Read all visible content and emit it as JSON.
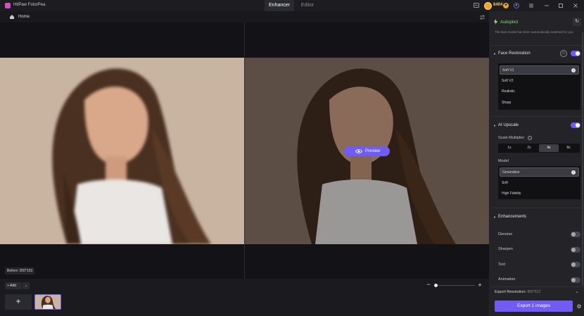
{
  "titlebar": {
    "app_title": "HitPaw FotorPea",
    "tabs": [
      {
        "label": "Enhancer",
        "active": true
      },
      {
        "label": "Editor",
        "active": false
      }
    ],
    "credits": "8404",
    "icons": [
      "message-icon",
      "coin-icon",
      "add-credits-icon",
      "account-icon",
      "menu-icon",
      "minimize-icon",
      "maximize-icon",
      "close-icon"
    ]
  },
  "homebar": {
    "home_label": "Home"
  },
  "canvas": {
    "preview_label": "Preview",
    "before_tag": "Before: 200*153"
  },
  "bottom": {
    "add_label": "Add",
    "add_icon": "+",
    "caret": "⌄",
    "zoom_minus": "−",
    "zoom_plus": "+",
    "zoom_level": 0.0,
    "thumb_add": "+"
  },
  "panel": {
    "autopilot_label": "Autopilot",
    "autopilot_desc": "The best model has been automatically matched for you",
    "face_restoration": {
      "label": "Face Restoration",
      "enabled": true,
      "options": [
        "Soft V1",
        "Soft V2",
        "Realistic",
        "Sharp"
      ],
      "selected": "Soft V1"
    },
    "ai_upscale": {
      "label": "AI Upscale",
      "enabled": true,
      "scale_label": "Scale Multiplier",
      "scales": [
        "1x",
        "2x",
        "4x",
        "8x"
      ],
      "selected_scale": "4x",
      "model_label": "Model",
      "models": [
        "Generative",
        "Soft",
        "High Fidelity"
      ],
      "selected_model": "Generative"
    },
    "enhancements": {
      "label": "Enhancements",
      "items": [
        {
          "label": "Denoise",
          "enabled": false
        },
        {
          "label": "Sharpen",
          "enabled": false
        },
        {
          "label": "Text",
          "enabled": false
        },
        {
          "label": "Animation",
          "enabled": false
        }
      ]
    },
    "export_res_label": "Export Resolution:",
    "export_res_value": "800*612",
    "export_button": "Export 1 images"
  },
  "colors": {
    "accent": "#6e5cf5",
    "autopilot": "#7de36a",
    "credits": "#f4c35b"
  }
}
